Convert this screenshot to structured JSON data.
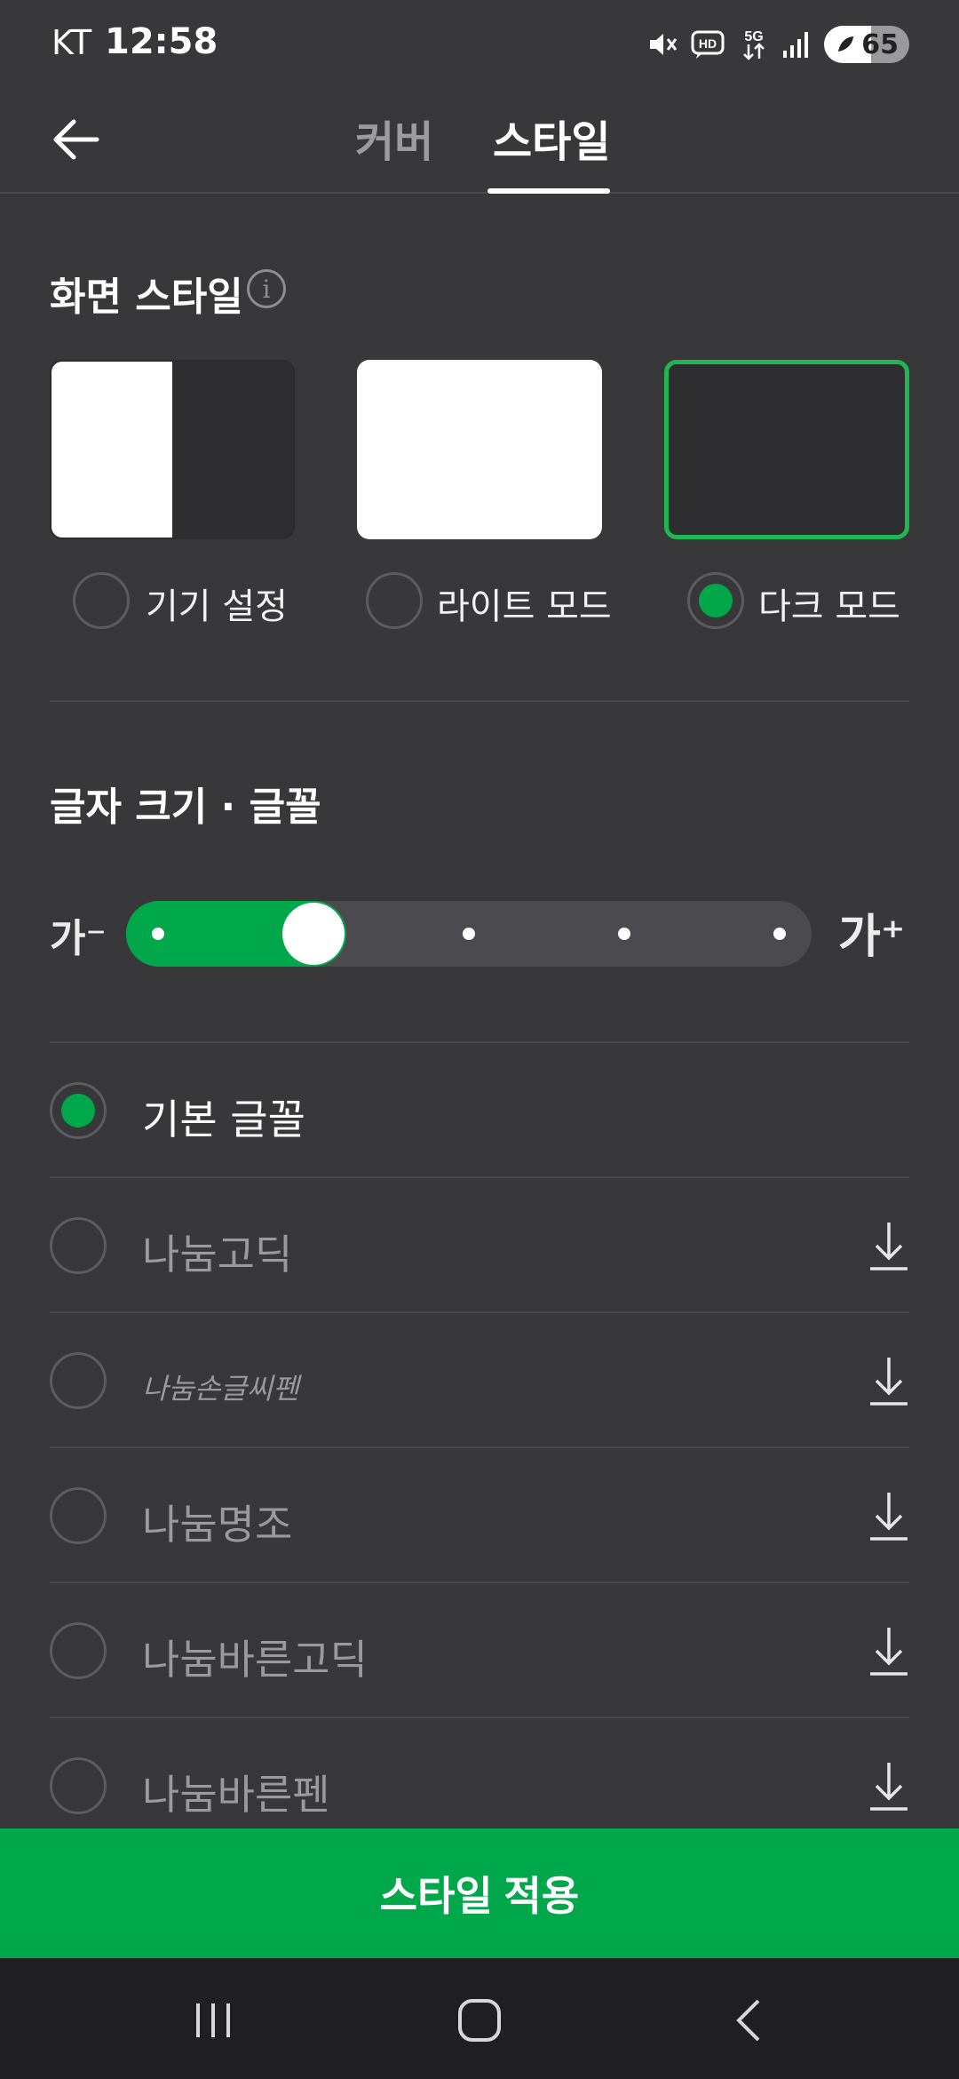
{
  "status_bar": {
    "carrier": "KT",
    "time": "12:58",
    "icons": [
      "mute-icon",
      "hd-voice-icon",
      "5g-icon",
      "signal-icon",
      "battery-icon"
    ],
    "battery_level": "65"
  },
  "topnav": {
    "tabs": [
      {
        "label": "커버",
        "active": false
      },
      {
        "label": "스타일",
        "active": true
      }
    ]
  },
  "screen_style": {
    "title": "화면 스타일",
    "options": [
      {
        "label": "기기 설정",
        "selected": false
      },
      {
        "label": "라이트 모드",
        "selected": false
      },
      {
        "label": "다크 모드",
        "selected": true
      }
    ]
  },
  "font_section": {
    "title": "글자 크기 · 글꼴",
    "size_decrease_label": "가⁻",
    "size_increase_label": "가⁺",
    "size_steps": 5,
    "size_selected_index": 1,
    "fonts": [
      {
        "label": "기본 글꼴",
        "selected": true,
        "downloadable": false
      },
      {
        "label": "나눔고딕",
        "selected": false,
        "downloadable": true
      },
      {
        "label": "나눔손글씨펜",
        "selected": false,
        "downloadable": true
      },
      {
        "label": "나눔명조",
        "selected": false,
        "downloadable": true
      },
      {
        "label": "나눔바른고딕",
        "selected": false,
        "downloadable": true
      },
      {
        "label": "나눔바른펜",
        "selected": false,
        "downloadable": true
      }
    ]
  },
  "apply_button": "스타일 적용",
  "colors": {
    "background": "#38383b",
    "accent": "#00a84b",
    "selected_border": "#1fb753"
  }
}
